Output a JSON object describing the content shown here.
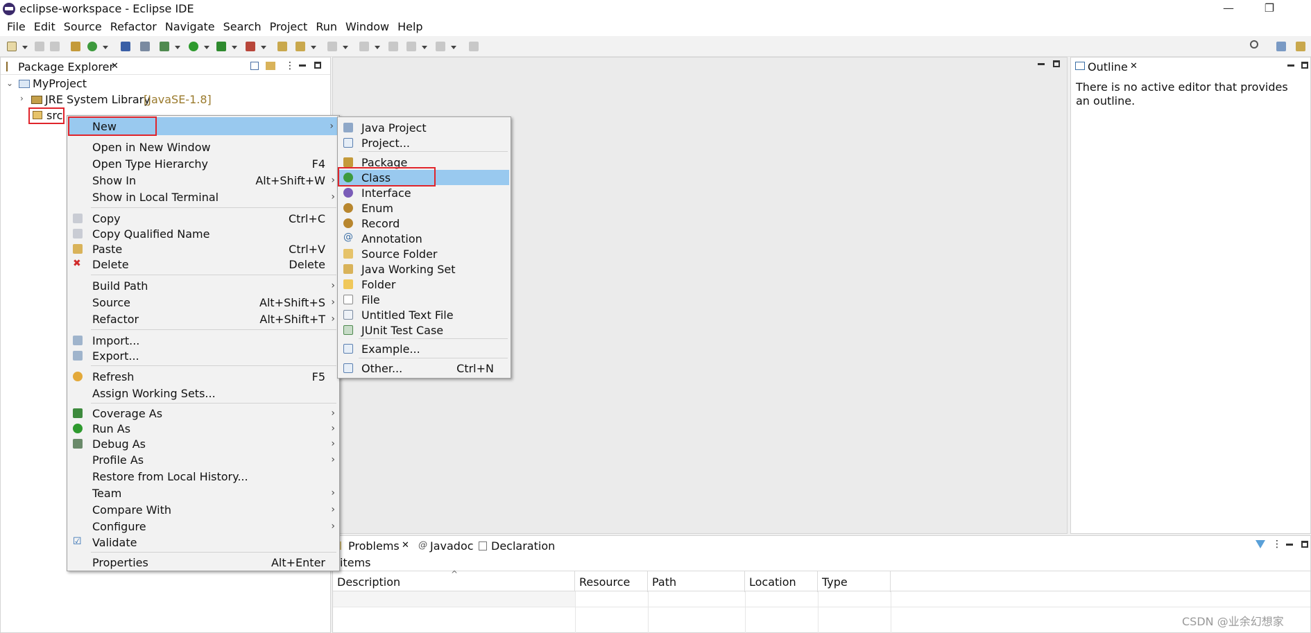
{
  "window": {
    "title": "eclipse-workspace - Eclipse IDE",
    "minimize": "—",
    "restore": "❐"
  },
  "menubar": [
    "File",
    "Edit",
    "Source",
    "Refactor",
    "Navigate",
    "Search",
    "Project",
    "Run",
    "Window",
    "Help"
  ],
  "package_explorer": {
    "tab": "Package Explorer",
    "close": "✕",
    "tree": {
      "project": "MyProject",
      "jre": "JRE System Library",
      "jre_version": "[JavaSE-1.8]",
      "src": "src"
    }
  },
  "outline": {
    "tab": "Outline",
    "close": "✕",
    "message": "There is no active editor that provides an outline."
  },
  "bottom_panel": {
    "tabs": [
      "Problems",
      "Javadoc",
      "Declaration"
    ],
    "problems_close": "✕",
    "items_label": "items",
    "columns": [
      "Description",
      "Resource",
      "Path",
      "Location",
      "Type"
    ]
  },
  "context_menu": {
    "new": "New",
    "items": [
      {
        "label": "Open in New Window",
        "shortcut": ""
      },
      {
        "label": "Open Type Hierarchy",
        "shortcut": "F4"
      },
      {
        "label": "Show In",
        "shortcut": "Alt+Shift+W"
      },
      {
        "label": "Show in Local Terminal",
        "shortcut": ""
      },
      {
        "label": "Copy",
        "shortcut": "Ctrl+C"
      },
      {
        "label": "Copy Qualified Name",
        "shortcut": ""
      },
      {
        "label": "Paste",
        "shortcut": "Ctrl+V"
      },
      {
        "label": "Delete",
        "shortcut": "Delete"
      },
      {
        "label": "Build Path",
        "shortcut": ""
      },
      {
        "label": "Source",
        "shortcut": "Alt+Shift+S"
      },
      {
        "label": "Refactor",
        "shortcut": "Alt+Shift+T"
      },
      {
        "label": "Import...",
        "shortcut": ""
      },
      {
        "label": "Export...",
        "shortcut": ""
      },
      {
        "label": "Refresh",
        "shortcut": "F5"
      },
      {
        "label": "Assign Working Sets...",
        "shortcut": ""
      },
      {
        "label": "Coverage As",
        "shortcut": ""
      },
      {
        "label": "Run As",
        "shortcut": ""
      },
      {
        "label": "Debug As",
        "shortcut": ""
      },
      {
        "label": "Profile As",
        "shortcut": ""
      },
      {
        "label": "Restore from Local History...",
        "shortcut": ""
      },
      {
        "label": "Team",
        "shortcut": ""
      },
      {
        "label": "Compare With",
        "shortcut": ""
      },
      {
        "label": "Configure",
        "shortcut": ""
      },
      {
        "label": "Validate",
        "shortcut": ""
      },
      {
        "label": "Properties",
        "shortcut": "Alt+Enter"
      }
    ]
  },
  "new_submenu": {
    "items": [
      {
        "label": "Java Project",
        "shortcut": ""
      },
      {
        "label": "Project...",
        "shortcut": ""
      },
      {
        "label": "Package",
        "shortcut": ""
      },
      {
        "label": "Class",
        "shortcut": ""
      },
      {
        "label": "Interface",
        "shortcut": ""
      },
      {
        "label": "Enum",
        "shortcut": ""
      },
      {
        "label": "Record",
        "shortcut": ""
      },
      {
        "label": "Annotation",
        "shortcut": ""
      },
      {
        "label": "Source Folder",
        "shortcut": ""
      },
      {
        "label": "Java Working Set",
        "shortcut": ""
      },
      {
        "label": "Folder",
        "shortcut": ""
      },
      {
        "label": "File",
        "shortcut": ""
      },
      {
        "label": "Untitled Text File",
        "shortcut": ""
      },
      {
        "label": "JUnit Test Case",
        "shortcut": ""
      },
      {
        "label": "Example...",
        "shortcut": ""
      },
      {
        "label": "Other...",
        "shortcut": "Ctrl+N"
      }
    ]
  },
  "watermark": "CSDN @业余幻想家",
  "colors": {
    "highlight": "#99c9ef",
    "annotation_box": "#e0242b",
    "jre_version": "#9a7a2c"
  }
}
